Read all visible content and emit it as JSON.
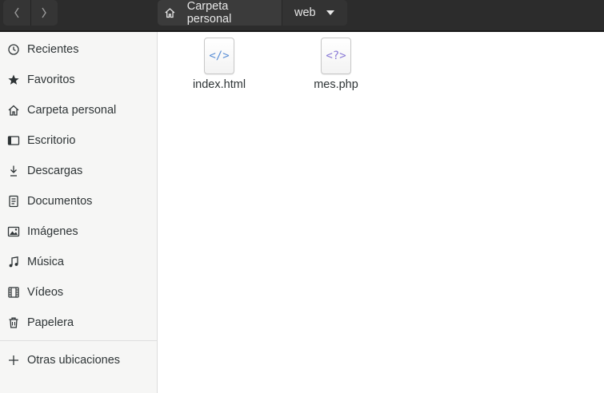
{
  "header": {
    "back_icon": "chevron-left-icon",
    "forward_icon": "chevron-right-icon",
    "path": [
      {
        "label": "Carpeta personal",
        "icon": "home-icon"
      },
      {
        "label": "web"
      }
    ],
    "dropdown_icon": "caret-down-icon"
  },
  "sidebar": {
    "items": [
      {
        "label": "Recientes",
        "icon": "clock-icon"
      },
      {
        "label": "Favoritos",
        "icon": "star-icon"
      },
      {
        "label": "Carpeta personal",
        "icon": "home-icon"
      },
      {
        "label": "Escritorio",
        "icon": "desktop-icon"
      },
      {
        "label": "Descargas",
        "icon": "download-icon"
      },
      {
        "label": "Documentos",
        "icon": "document-icon"
      },
      {
        "label": "Imágenes",
        "icon": "image-icon"
      },
      {
        "label": "Música",
        "icon": "music-icon"
      },
      {
        "label": "Vídeos",
        "icon": "video-icon"
      },
      {
        "label": "Papelera",
        "icon": "trash-icon"
      }
    ],
    "other_locations": {
      "label": "Otras ubicaciones",
      "icon": "plus-icon"
    }
  },
  "files": [
    {
      "name": "index.html",
      "glyph": "</>",
      "glyph_color": "#5b8fd6"
    },
    {
      "name": "mes.php",
      "glyph": "<?>",
      "glyph_color": "#8a7ad6"
    }
  ]
}
